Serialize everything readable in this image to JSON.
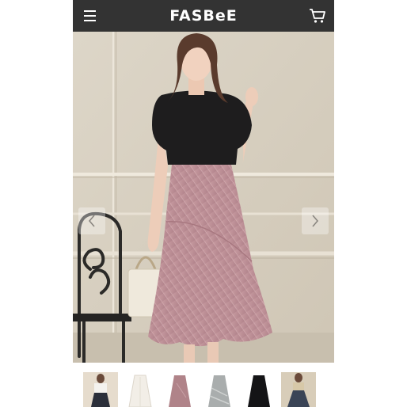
{
  "header": {
    "logo_text": "FASBeE",
    "menu_icon": "hamburger-menu-icon",
    "cart_icon": "shopping-cart-icon",
    "background_color": "#333333"
  },
  "gallery": {
    "prev_icon": "chevron-left-icon",
    "next_icon": "chevron-right-icon",
    "thumbnails": [
      {
        "name": "model-front-thumbnail"
      },
      {
        "name": "white-skirt-thumbnail"
      },
      {
        "name": "pink-skirt-thumbnail"
      },
      {
        "name": "gray-skirt-thumbnail"
      },
      {
        "name": "black-skirt-thumbnail"
      },
      {
        "name": "navy-skirt-model-thumbnail"
      }
    ]
  }
}
